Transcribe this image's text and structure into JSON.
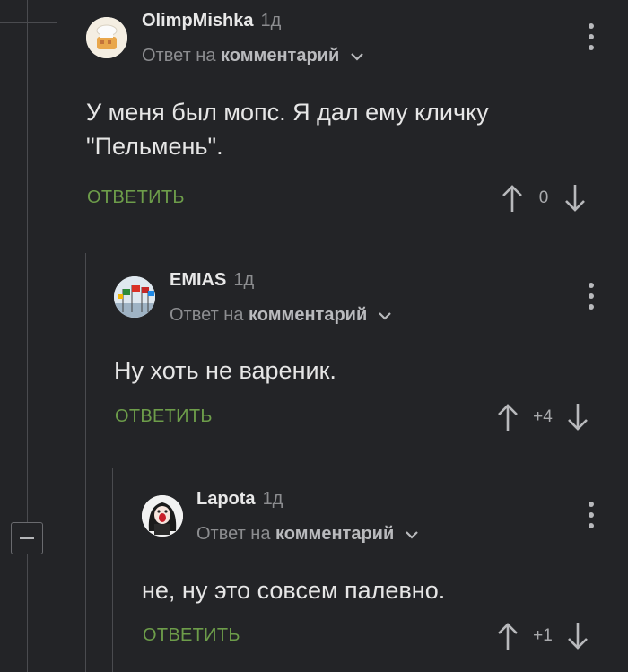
{
  "comments": [
    {
      "author": "OlimpMishka",
      "time": "1д",
      "reply_prefix": "Ответ на",
      "reply_target": "комментарий",
      "text": "У меня был мопс. Я дал ему кличку \"Пельмень\".",
      "reply_label": "ОТВЕТИТЬ",
      "score": "0"
    },
    {
      "author": "EMIAS",
      "time": "1д",
      "reply_prefix": "Ответ на",
      "reply_target": "комментарий",
      "text": "Ну хоть не вареник.",
      "reply_label": "ОТВЕТИТЬ",
      "score": "+4"
    },
    {
      "author": "Lapota",
      "time": "1д",
      "reply_prefix": "Ответ на",
      "reply_target": "комментарий",
      "text": "не, ну это совсем палевно.",
      "reply_label": "ОТВЕТИТЬ",
      "score": "+1"
    }
  ],
  "colors": {
    "background": "#232427",
    "reply_button": "#6d9d4a",
    "thread_line": "#4a4b4f"
  },
  "icons": [
    "collapse-icon",
    "chevron-down-icon",
    "more-vert-icon",
    "arrow-up-icon",
    "arrow-down-icon"
  ]
}
